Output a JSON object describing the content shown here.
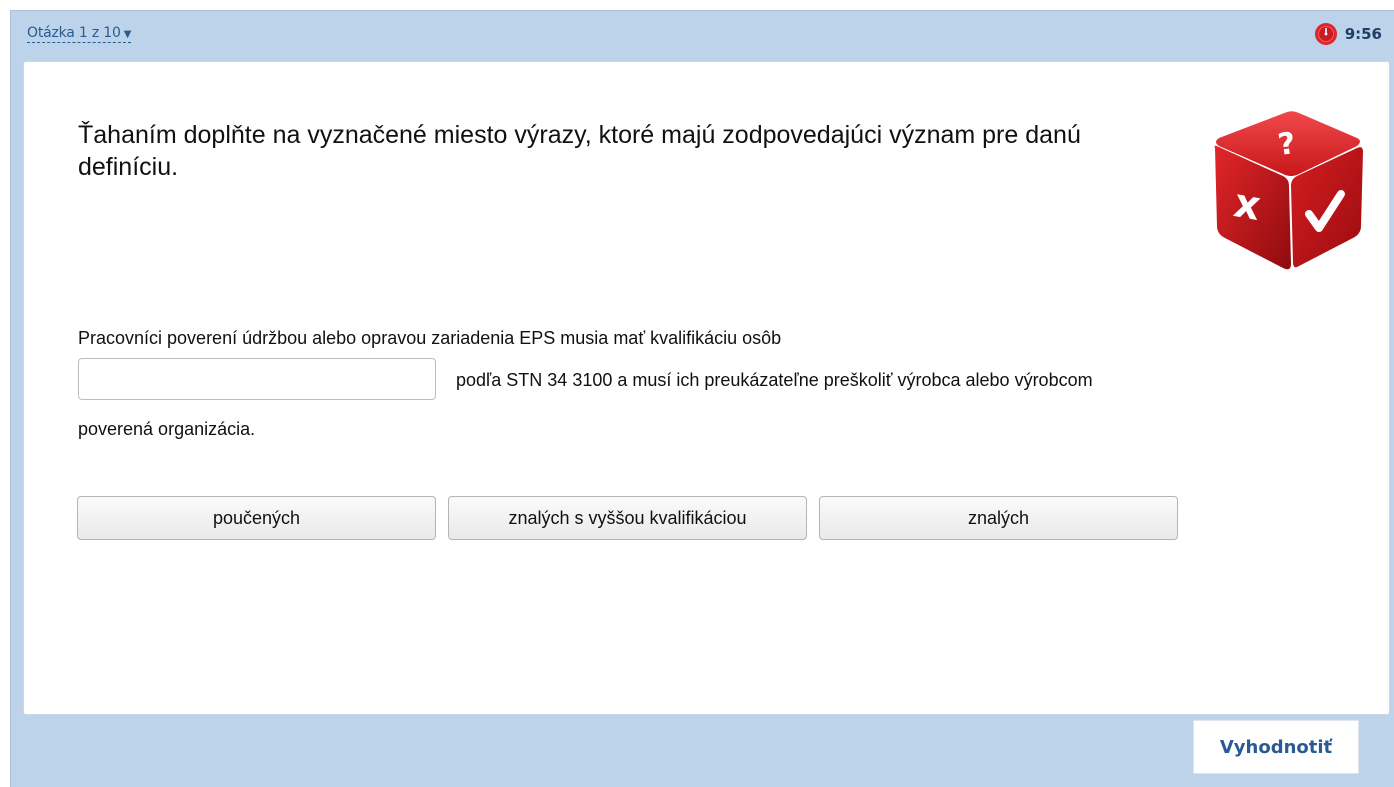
{
  "header": {
    "question_nav": "Otázka 1 z 10",
    "timer": "9:56"
  },
  "question": {
    "prompt": "Ťahaním doplňte na vyznačené miesto výrazy, ktoré majú zodpovedajúci význam pre danú definíciu.",
    "line1": "Pracovníci poverení údržbou alebo opravou zariadenia EPS musia mať kvalifikáciu osôb",
    "line2_after_gap": "podľa STN 34 3100 a musí ich preukázateľne preškoliť výrobca alebo výrobcom",
    "line3": "poverená organizácia.",
    "drop_value": "",
    "options": [
      "poučených",
      "znalých s vyššou kvalifikáciou",
      "znalých"
    ]
  },
  "footer": {
    "evaluate_label": "Vyhodnotiť"
  },
  "icons": {
    "timer": "stopwatch-icon",
    "nav_caret": "caret-down-icon",
    "illustration": "quiz-dice-icon"
  },
  "colors": {
    "frame_bg": "#bcd3ea",
    "accent": "#2a5a93",
    "timer_red": "#e0252b",
    "dice_red": "#d41b1f"
  }
}
